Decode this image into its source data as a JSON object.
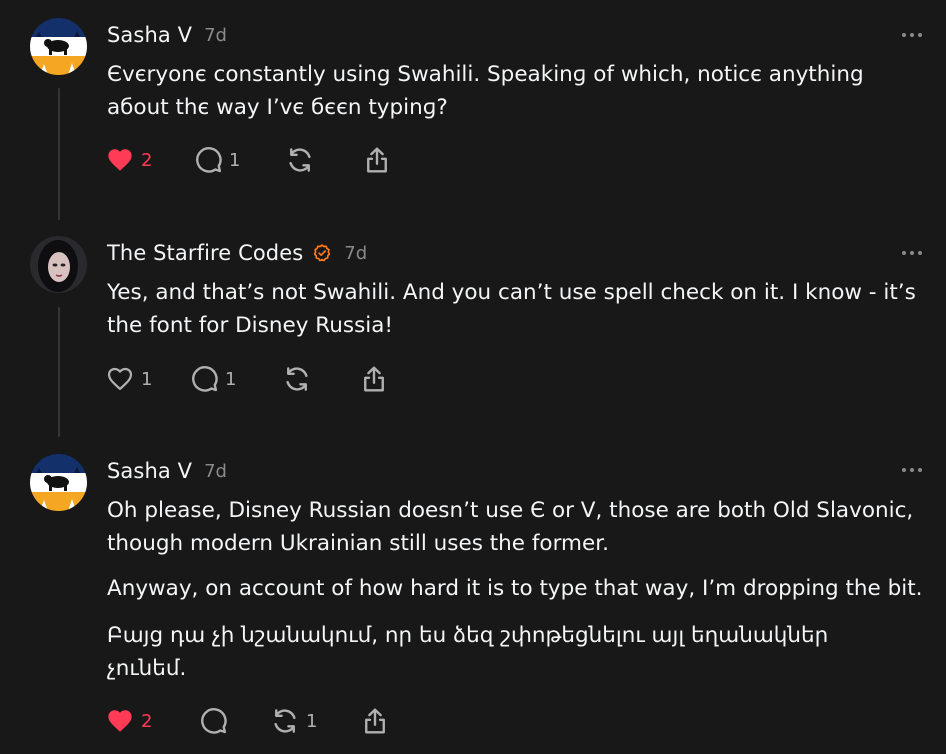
{
  "icons": {
    "more": "more-horizontal-icon",
    "like": "heart-icon",
    "reply": "comment-bubble-icon",
    "repost": "repost-icon",
    "share": "share-icon",
    "verified": "verified-badge-icon"
  },
  "colors": {
    "background": "#181818",
    "liked": "#ff3b55",
    "verified_badge": "#ff7a1a",
    "muted": "#8a8a8a"
  },
  "posts": [
    {
      "author": "Sasha V",
      "time": "7d",
      "verified": false,
      "paragraphs": [
        "Єvєryonє constantly using Swahili. Speakinɡ of which, noticє anything\naбout thє way I’vє бєєn typinɡ?"
      ],
      "likes": "2",
      "liked": true,
      "replies": "1",
      "reposts": ""
    },
    {
      "author": "The Starfire Codes",
      "time": "7d",
      "verified": true,
      "paragraphs": [
        "Yes, and that’s not Swahili. And you can’t use spell check on it. I know - it’s\nthe font for Disney Russia!"
      ],
      "likes": "1",
      "liked": false,
      "replies": "1",
      "reposts": ""
    },
    {
      "author": "Sasha V",
      "time": "7d",
      "verified": false,
      "paragraphs": [
        "Oh please, Disney Russian doesn’t use Є or V, those are both Old Slavonic,\nthough modern Ukrainian still uses the former.",
        "Anyway, on account of how hard it is to type that way, I’m dropping the bit.",
        "Բայց դա չի նշանակում, որ ես ձեզ շփոթեցնելու այլ եղանակներ\nչունեմ."
      ],
      "likes": "2",
      "liked": true,
      "replies": "",
      "reposts": "1"
    }
  ]
}
